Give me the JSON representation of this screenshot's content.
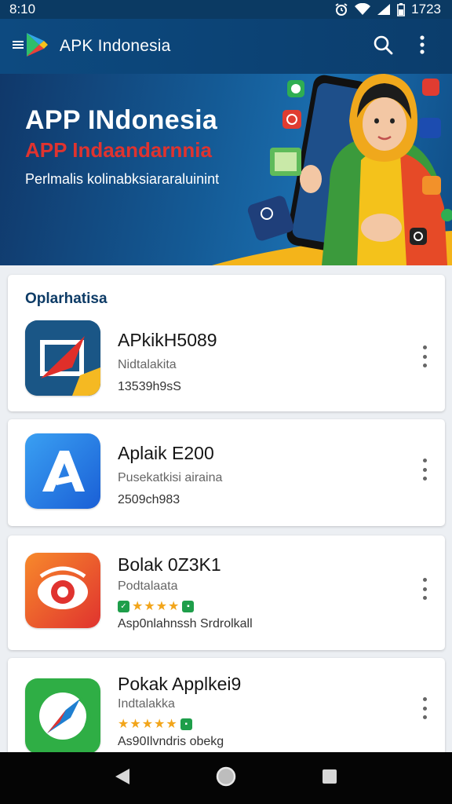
{
  "status_bar": {
    "time": "8:10",
    "battery": "1723"
  },
  "app_bar": {
    "title": "APK Indonesia"
  },
  "banner": {
    "title": "APP INdonesia",
    "subtitle": "APP Indaandarnnia",
    "description": "Perlmalis kolinabksiararaluinint"
  },
  "section": {
    "title": "Oplarhatisa"
  },
  "apps": [
    {
      "name": "APkikH5089",
      "subtitle": "Nidtalakita",
      "meta": "13539h9sS"
    },
    {
      "name": "Aplaik E200",
      "subtitle": "Pusekatkisi airaina",
      "meta": "2509ch983"
    },
    {
      "name": "Bolak 0Z3K1",
      "subtitle": "Podtalaata",
      "rating_stars": "★★★★",
      "meta": "Asp0nlahnssh Srdrolkall"
    },
    {
      "name": "Pokak Applkei9",
      "subtitle": "Indtalakka",
      "rating_stars": "★★★★★",
      "meta": "As90Ilvndris obekg"
    }
  ],
  "colors": {
    "app_bar": "#0d4a80",
    "accent_red": "#e0332f",
    "star": "#f2a51a"
  }
}
